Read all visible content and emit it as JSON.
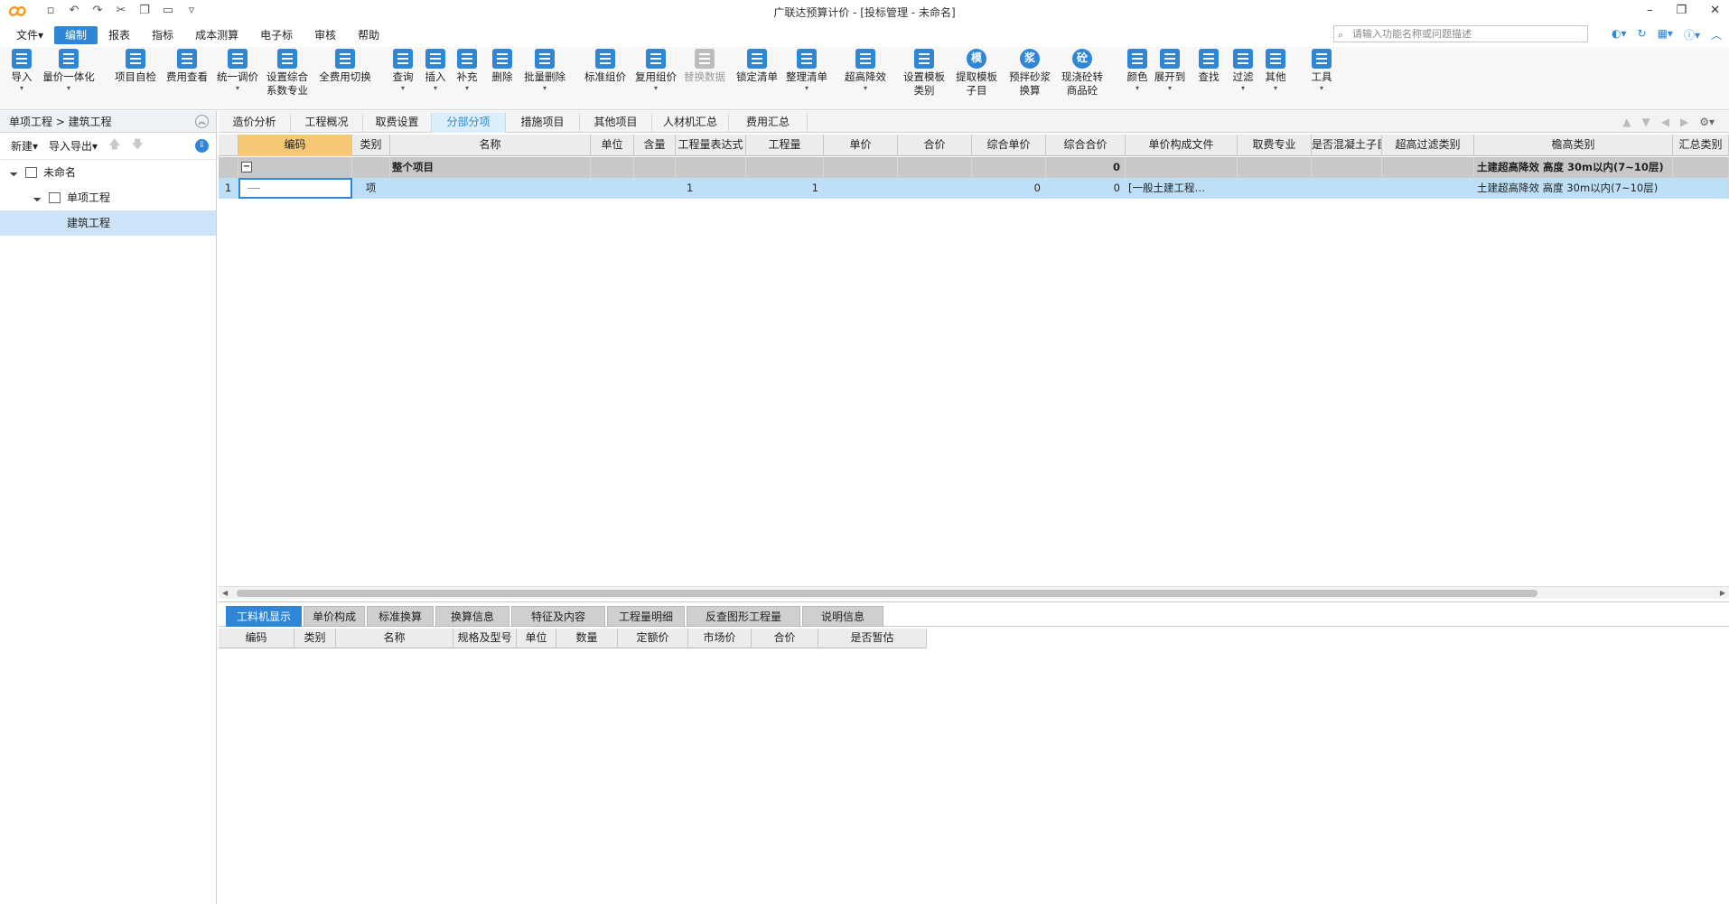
{
  "app": {
    "title": "广联达预算计价 - [投标管理 - 未命名]"
  },
  "menu": {
    "items": [
      "文件▾",
      "编制",
      "报表",
      "指标",
      "成本测算",
      "电子标",
      "审核",
      "帮助"
    ],
    "active_index": 1,
    "search_placeholder": "请输入功能名称或问题描述"
  },
  "ribbon": {
    "buttons": [
      {
        "label": "导入",
        "sub": "",
        "icon": "import-icon",
        "dropdown": true
      },
      {
        "label": "量价一体化",
        "sub": "",
        "icon": "quantity-price-icon",
        "dropdown": true
      },
      {
        "label": "项目自检",
        "sub": "",
        "icon": "self-check-icon",
        "dropdown": false
      },
      {
        "label": "费用查看",
        "sub": "",
        "icon": "fee-view-icon",
        "dropdown": false
      },
      {
        "label": "统一调价",
        "sub": "",
        "icon": "unify-price-icon",
        "dropdown": true
      },
      {
        "label": "设置综合",
        "sub": "系数专业",
        "icon": "set-coef-icon",
        "dropdown": false
      },
      {
        "label": "全费用切换",
        "sub": "",
        "icon": "full-fee-icon",
        "dropdown": false
      },
      {
        "label": "查询",
        "sub": "",
        "icon": "query-icon",
        "dropdown": true
      },
      {
        "label": "插入",
        "sub": "",
        "icon": "insert-icon",
        "dropdown": true
      },
      {
        "label": "补充",
        "sub": "",
        "icon": "supplement-icon",
        "dropdown": true
      },
      {
        "label": "删除",
        "sub": "",
        "icon": "delete-icon",
        "dropdown": false
      },
      {
        "label": "批量删除",
        "sub": "",
        "icon": "batch-delete-icon",
        "dropdown": true
      },
      {
        "label": "标准组价",
        "sub": "",
        "icon": "standard-price-icon",
        "dropdown": false
      },
      {
        "label": "复用组价",
        "sub": "",
        "icon": "reuse-price-icon",
        "dropdown": true
      },
      {
        "label": "替换数据",
        "sub": "",
        "icon": "replace-data-icon",
        "dropdown": false,
        "disabled": true
      },
      {
        "label": "锁定清单",
        "sub": "",
        "icon": "lock-icon",
        "dropdown": false
      },
      {
        "label": "整理清单",
        "sub": "",
        "icon": "organize-list-icon",
        "dropdown": true
      },
      {
        "label": "超高降效",
        "sub": "",
        "icon": "super-high-icon",
        "dropdown": true
      },
      {
        "label": "设置模板",
        "sub": "类别",
        "icon": "template-icon",
        "dropdown": false
      },
      {
        "label": "提取模板",
        "sub": "子目",
        "icon": "extract-template-icon",
        "glyph": "模",
        "dropdown": false
      },
      {
        "label": "预拌砂浆",
        "sub": "换算",
        "icon": "mortar-icon",
        "glyph": "浆",
        "dropdown": false
      },
      {
        "label": "现浇砼转",
        "sub": "商品砼",
        "icon": "concrete-icon",
        "glyph": "砼",
        "dropdown": false
      },
      {
        "label": "颜色",
        "sub": "",
        "icon": "color-icon",
        "dropdown": true
      },
      {
        "label": "展开到",
        "sub": "",
        "icon": "expand-icon",
        "dropdown": true
      },
      {
        "label": "查找",
        "sub": "",
        "icon": "find-icon",
        "dropdown": false
      },
      {
        "label": "过滤",
        "sub": "",
        "icon": "filter-icon",
        "dropdown": true
      },
      {
        "label": "其他",
        "sub": "",
        "icon": "other-icon",
        "dropdown": true
      },
      {
        "label": "工具",
        "sub": "",
        "icon": "tools-icon",
        "dropdown": true
      }
    ]
  },
  "left_panel": {
    "breadcrumb": "单项工程 > 建筑工程",
    "new_label": "新建▾",
    "import_export_label": "导入导出▾",
    "tree": [
      {
        "label": "未命名",
        "level": 0,
        "icon": "building-icon"
      },
      {
        "label": "单项工程",
        "level": 1,
        "icon": "home-icon"
      },
      {
        "label": "建筑工程",
        "level": 2,
        "icon": "",
        "selected": true
      }
    ]
  },
  "tabs": {
    "items": [
      "造价分析",
      "工程概况",
      "取费设置",
      "分部分项",
      "措施项目",
      "其他项目",
      "人材机汇总",
      "费用汇总"
    ],
    "active_index": 3
  },
  "grid": {
    "columns": [
      "编码",
      "类别",
      "名称",
      "单位",
      "含量",
      "工程量表达式",
      "工程量",
      "单价",
      "合价",
      "综合单价",
      "综合合价",
      "单价构成文件",
      "取费专业",
      "是否混凝土子目",
      "超高过滤类别",
      "檐高类别",
      "汇总类别"
    ],
    "rows": [
      {
        "no": "",
        "code": "",
        "type": "",
        "name": "整个项目",
        "unit": "",
        "content": "",
        "expr": "",
        "qty": "",
        "price": "",
        "total": "",
        "unit_comp": "",
        "comp_total": "0",
        "price_file": "",
        "fee_major": "",
        "is_concrete": "",
        "super_filter": "",
        "eave_type": "土建超高降效 高度 30m以内(7~10层)",
        "summary": ""
      },
      {
        "no": "1",
        "code": "",
        "type": "项",
        "name": "",
        "unit": "",
        "content": "",
        "expr": "1",
        "qty": "1",
        "price": "",
        "total": "",
        "unit_comp": "0",
        "comp_total": "0",
        "price_file": "[一般土建工程…",
        "fee_major": "",
        "is_concrete": "",
        "super_filter": "",
        "eave_type": "土建超高降效 高度 30m以内(7~10层)",
        "summary": ""
      }
    ]
  },
  "bottom": {
    "tabs": [
      "工料机显示",
      "单价构成",
      "标准换算",
      "换算信息",
      "特征及内容",
      "工程量明细",
      "反查图形工程量",
      "说明信息"
    ],
    "active_index": 0,
    "columns": [
      "编码",
      "类别",
      "名称",
      "规格及型号",
      "单位",
      "数量",
      "定额价",
      "市场价",
      "合价",
      "是否暂估"
    ]
  },
  "colors": {
    "accent": "#2f86d6",
    "selected_row": "#bde0f8",
    "group_row": "#c8c8c8",
    "highlight_header": "#f6c876"
  }
}
